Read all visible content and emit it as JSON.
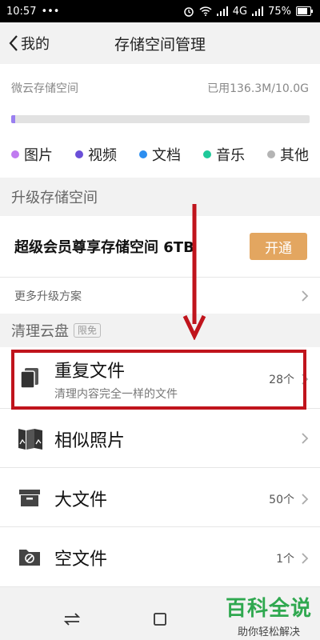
{
  "status_bar": {
    "time": "10:57",
    "dots": "•••",
    "network": "4G",
    "battery": "75%"
  },
  "nav": {
    "back_label": "我的",
    "title": "存储空间管理"
  },
  "storage": {
    "label": "微云存储空间",
    "usage": "已用136.3M/10.0G",
    "used_fraction": 0.013,
    "legend": [
      {
        "label": "图片",
        "color": "#c07bf0"
      },
      {
        "label": "视频",
        "color": "#6a4fd8"
      },
      {
        "label": "文档",
        "color": "#2c8ef0"
      },
      {
        "label": "音乐",
        "color": "#1fc99a"
      },
      {
        "label": "其他",
        "color": "#b4b4b4"
      }
    ]
  },
  "upgrade": {
    "section_title": "升级存储空间",
    "offer_text": "超级会员尊享存储空间 6TB",
    "open_button": "开通",
    "more_plans": "更多升级方案"
  },
  "cleanup": {
    "section_title": "清理云盘",
    "tag": "限免",
    "items": [
      {
        "title": "重复文件",
        "subtitle": "清理内容完全一样的文件",
        "count": "28个",
        "icon": "duplicate-files-icon"
      },
      {
        "title": "相似照片",
        "subtitle": "",
        "count": "",
        "icon": "similar-photos-icon"
      },
      {
        "title": "大文件",
        "subtitle": "",
        "count": "50个",
        "icon": "large-file-icon"
      },
      {
        "title": "空文件",
        "subtitle": "",
        "count": "1个",
        "icon": "empty-file-icon"
      }
    ]
  },
  "watermark": {
    "main": "百科全说",
    "sub": "助你轻松解决"
  },
  "colors": {
    "accent_button": "#e3a660",
    "highlight": "#c0141c",
    "watermark": "#2fa84f"
  }
}
